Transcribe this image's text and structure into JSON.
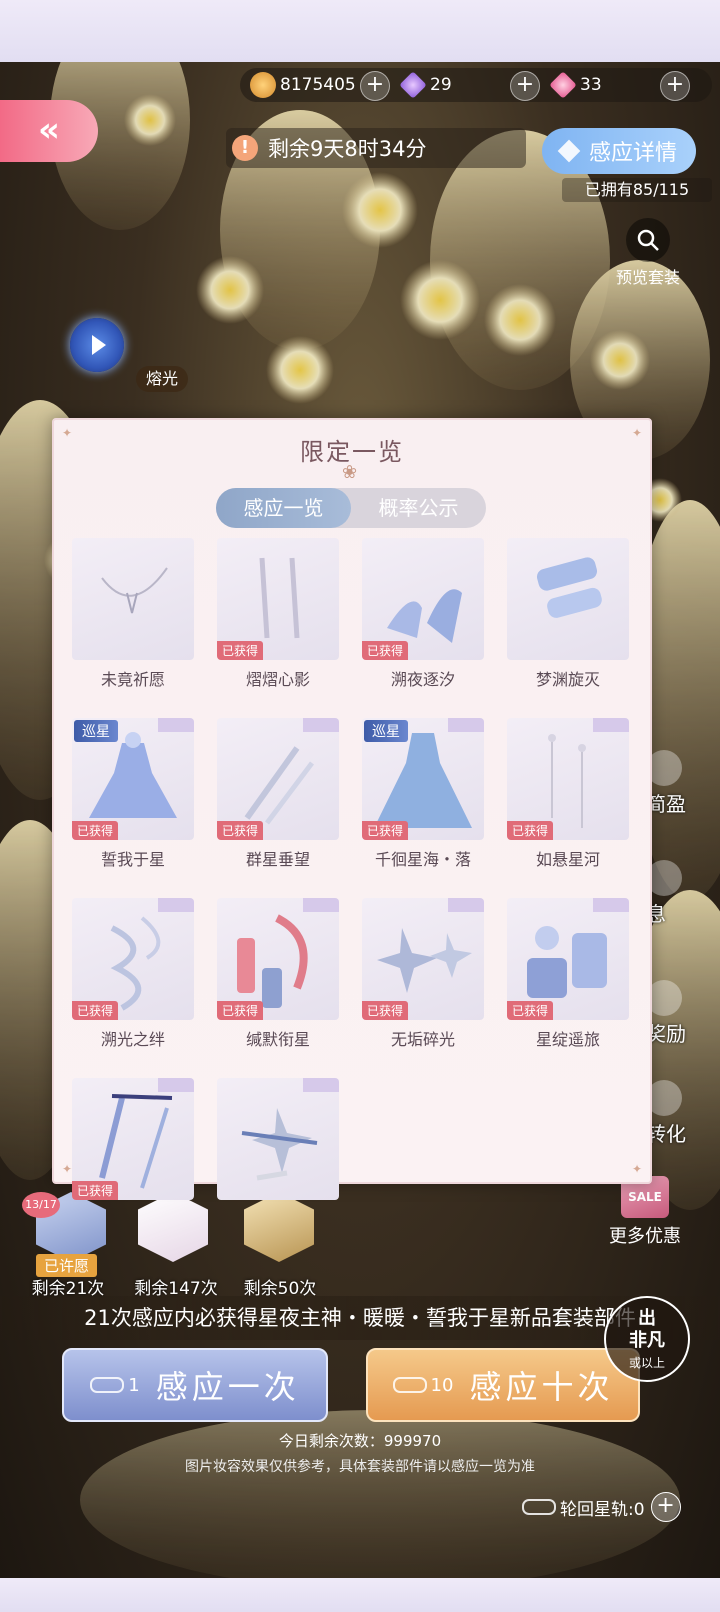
{
  "currency": {
    "gold_value": "8175405",
    "purple_diamond_value": "29",
    "pink_diamond_value": "33",
    "plus_label": "+"
  },
  "header": {
    "timer_icon_glyph": "!",
    "timer_text": "剩余9天8时34分",
    "detail_label": "感应详情",
    "owned_text": "已拥有85/115",
    "preview_label": "预览套装",
    "melt_label": "熔光",
    "back_glyph": "«"
  },
  "side": {
    "label_1": "简盈",
    "label_2": "息",
    "label_3": "奖励",
    "label_4": "转化"
  },
  "modal": {
    "title": "限定一览",
    "tabs": [
      {
        "label": "感应一览",
        "active": true
      },
      {
        "label": "概率公示",
        "active": false
      }
    ],
    "obtained_label": "已获得",
    "star_label": "巡星",
    "items": [
      {
        "name": "未竟祈愿",
        "obtained": false,
        "star": false,
        "art": "necklace"
      },
      {
        "name": "熠熠心影",
        "obtained": true,
        "star": false,
        "art": "gloves"
      },
      {
        "name": "溯夜逐汐",
        "obtained": true,
        "star": false,
        "art": "heels"
      },
      {
        "name": "梦渊旋灭",
        "obtained": false,
        "star": false,
        "art": "socks"
      },
      {
        "name": "誓我于星",
        "obtained": true,
        "star": true,
        "art": "dress"
      },
      {
        "name": "群星垂望",
        "obtained": true,
        "star": false,
        "art": "glove-long"
      },
      {
        "name": "千徊星海・落",
        "obtained": true,
        "star": true,
        "art": "gown"
      },
      {
        "name": "如悬星河",
        "obtained": true,
        "star": false,
        "art": "earrings"
      },
      {
        "name": "溯光之绊",
        "obtained": true,
        "star": false,
        "art": "ribbon"
      },
      {
        "name": "缄默衔星",
        "obtained": true,
        "star": false,
        "art": "lipstick"
      },
      {
        "name": "无垢碎光",
        "obtained": true,
        "star": false,
        "art": "stars"
      },
      {
        "name": "星绽遥旅",
        "obtained": true,
        "star": false,
        "art": "set"
      },
      {
        "name": "",
        "obtained": true,
        "star": false,
        "art": "wand"
      },
      {
        "name": "",
        "obtained": false,
        "star": false,
        "art": "hairpin"
      }
    ]
  },
  "pulls": {
    "counter": "13/17",
    "wished_label": "已许愿",
    "remaining": [
      "剩余21次",
      "剩余147次",
      "剩余50次"
    ]
  },
  "more_deals_label": "更多优惠",
  "sale_label": "SALE",
  "guarantee_text": "21次感应内必获得星夜主神・暖暖・誓我于星新品套装部件",
  "seal": {
    "line1": "出",
    "line2": "非凡",
    "line3": "或以上"
  },
  "draw_one": {
    "count": "1",
    "label": "感应一次"
  },
  "draw_ten": {
    "count": "10",
    "label": "感应十次"
  },
  "remaining_today": "今日剩余次数：999970",
  "disclaimer": "图片妆容效果仅供参考，具体套装部件请以感应一览为准",
  "orbit": {
    "label": "轮回星轨:0",
    "plus": "+"
  },
  "colors": {
    "accent_pink": "#f26a86",
    "accent_blue": "#7fb4f2",
    "obtained_badge": "#e06b78",
    "gold_button": "#e59a51",
    "blue_button": "#7e8fcd"
  }
}
